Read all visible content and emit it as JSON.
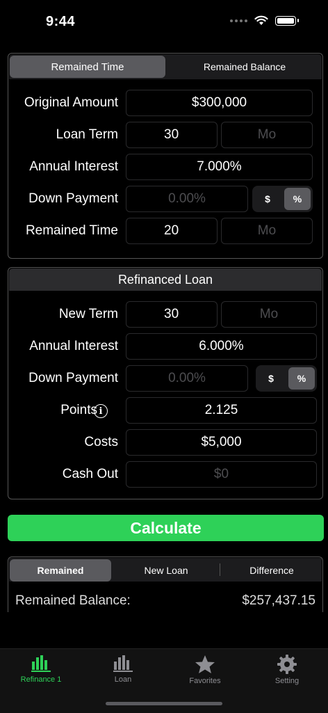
{
  "status": {
    "time": "9:44"
  },
  "panel1": {
    "tabs": [
      "Remained Time",
      "Remained Balance"
    ],
    "original_amount": {
      "label": "Original Amount",
      "value": "$300,000"
    },
    "loan_term": {
      "label": "Loan Term",
      "value": "30",
      "unit_placeholder": "Mo"
    },
    "annual_interest": {
      "label": "Annual Interest",
      "value": "7.000%"
    },
    "down_payment": {
      "label": "Down Payment",
      "placeholder": "0.00%",
      "toggle": [
        "$",
        "%"
      ]
    },
    "remained_time": {
      "label": "Remained Time",
      "value": "20",
      "unit_placeholder": "Mo"
    }
  },
  "panel2": {
    "title": "Refinanced Loan",
    "new_term": {
      "label": "New Term",
      "value": "30",
      "unit_placeholder": "Mo"
    },
    "annual_interest": {
      "label": "Annual Interest",
      "value": "6.000%"
    },
    "down_payment": {
      "label": "Down Payment",
      "placeholder": "0.00%",
      "toggle": [
        "$",
        "%"
      ]
    },
    "points": {
      "label": "Points",
      "value": "2.125"
    },
    "costs": {
      "label": "Costs",
      "value": "$5,000"
    },
    "cash_out": {
      "label": "Cash Out",
      "placeholder": "$0"
    }
  },
  "calculate": "Calculate",
  "results": {
    "tabs": [
      "Remained",
      "New Loan",
      "Difference"
    ],
    "balance_label": "Remained Balance:",
    "balance_value": "$257,437.15"
  },
  "tabbar": [
    {
      "label": "Refinance 1",
      "icon": "chart-bars-icon",
      "active": true
    },
    {
      "label": "Loan",
      "icon": "chart-bars-icon",
      "active": false
    },
    {
      "label": "Favorites",
      "icon": "star-icon",
      "active": false
    },
    {
      "label": "Setting",
      "icon": "gear-icon",
      "active": false
    }
  ],
  "colors": {
    "accent": "#2ed158",
    "background": "#000000"
  }
}
